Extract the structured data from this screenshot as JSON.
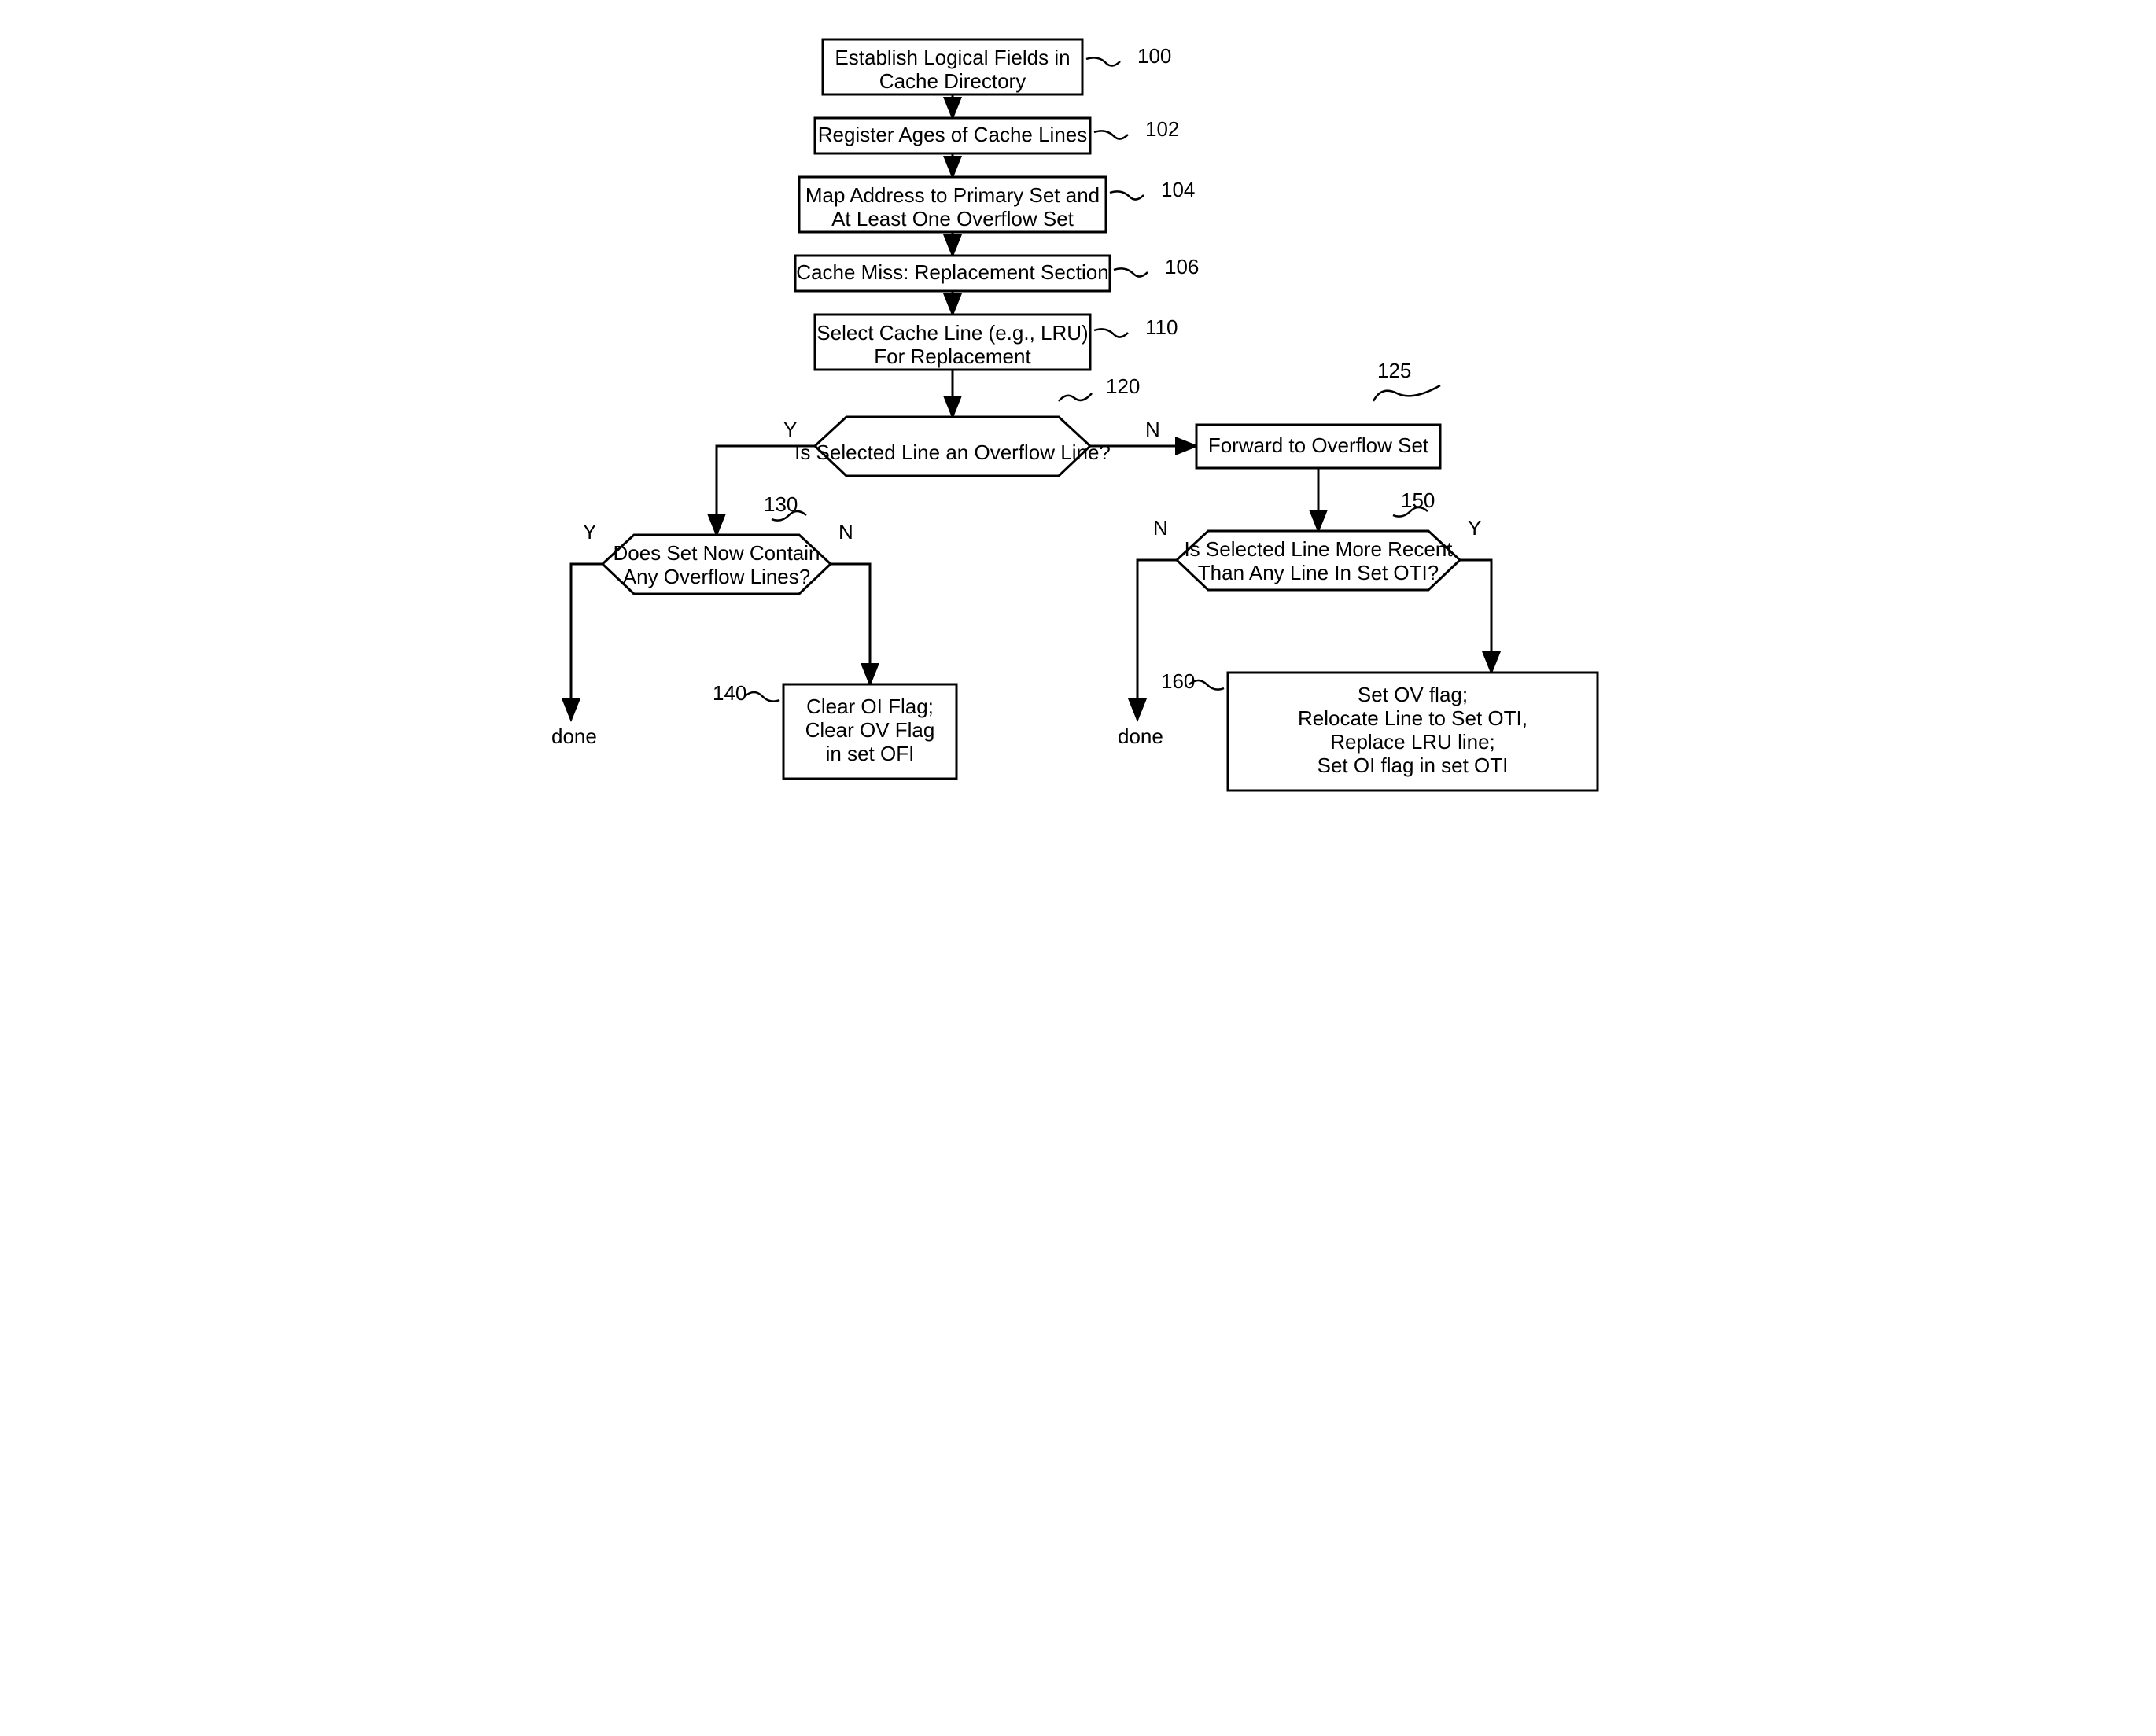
{
  "boxes": {
    "b100": {
      "line1": "Establish Logical Fields in",
      "line2": "Cache Directory",
      "ref": "100"
    },
    "b102": {
      "line1": "Register Ages of Cache Lines",
      "ref": "102"
    },
    "b104": {
      "line1": "Map Address to Primary Set and",
      "line2": "At Least One Overflow Set",
      "ref": "104"
    },
    "b106": {
      "line1": "Cache Miss: Replacement Section",
      "ref": "106"
    },
    "b110": {
      "line1": "Select Cache Line (e.g., LRU)",
      "line2": "For Replacement",
      "ref": "110"
    },
    "b125": {
      "line1": "Forward to Overflow Set",
      "ref": "125"
    },
    "b140": {
      "line1": "Clear OI Flag;",
      "line2": "Clear OV Flag",
      "line3": "in set OFI",
      "ref": "140"
    },
    "b160": {
      "line1": "Set OV flag;",
      "line2": "Relocate Line to Set OTI,",
      "line3": "Replace LRU line;",
      "line4": "Set OI flag in set OTI",
      "ref": "160"
    }
  },
  "decisions": {
    "d120": {
      "text": "Is Selected Line an Overflow Line?",
      "ref": "120",
      "yes": "Y",
      "no": "N"
    },
    "d130": {
      "line1": "Does Set Now Contain",
      "line2": "Any Overflow Lines?",
      "ref": "130",
      "yes": "Y",
      "no": "N"
    },
    "d150": {
      "line1": "Is Selected Line More Recent",
      "line2": "Than Any Line In Set OTI?",
      "ref": "150",
      "yes": "Y",
      "no": "N"
    }
  },
  "terminals": {
    "done1": "done",
    "done2": "done"
  }
}
